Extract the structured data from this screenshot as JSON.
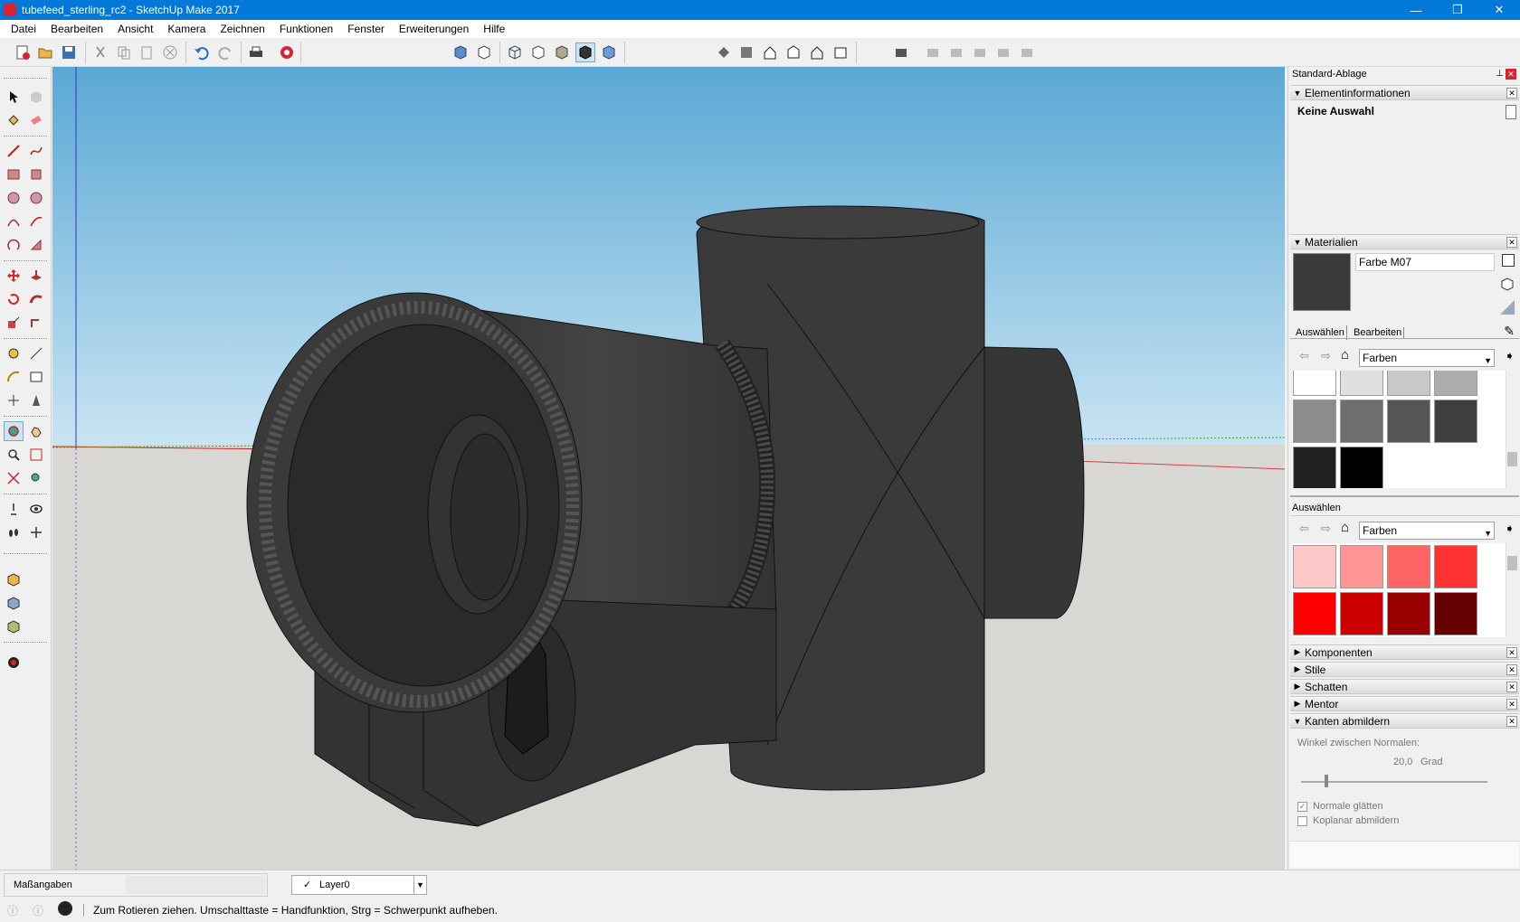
{
  "window": {
    "title": "tubefeed_sterling_rc2 - SketchUp Make 2017",
    "minimize": "—",
    "restore": "❐",
    "close": "✕"
  },
  "menu": [
    "Datei",
    "Bearbeiten",
    "Ansicht",
    "Kamera",
    "Zeichnen",
    "Funktionen",
    "Fenster",
    "Erweiterungen",
    "Hilfe"
  ],
  "panel": {
    "title": "Standard-Ablage",
    "entity_info": {
      "header": "Elementinformationen",
      "selection": "Keine Auswahl"
    },
    "materials": {
      "header": "Materialien",
      "material_name": "Farbe M07",
      "tab_select": "Auswählen",
      "tab_edit": "Bearbeiten",
      "library": "Farben",
      "current_color": "#3a3a3a",
      "gray_swatches": [
        "#ffffff",
        "#e0e0e0",
        "#c8c8c8",
        "#acacac",
        "#8c8c8c",
        "#6e6e6e",
        "#555555",
        "#3e3e3e",
        "#222222",
        "#000000"
      ],
      "secondary_label": "Auswählen",
      "secondary_library": "Farben",
      "red_swatches": [
        "#ffc8c8",
        "#ff9696",
        "#ff6464",
        "#ff3232",
        "#ff0000",
        "#cc0000",
        "#990000",
        "#660000"
      ]
    },
    "collapsed_sections": [
      "Komponenten",
      "Stile",
      "Schatten",
      "Mentor"
    ],
    "soften_edges": {
      "header": "Kanten abmildern",
      "angle_label": "Winkel zwischen Normalen:",
      "angle_value": "20,0",
      "angle_unit": "Grad",
      "smooth_normals": "Normale glätten",
      "soften_coplanar": "Koplanar abmildern"
    }
  },
  "status": {
    "measurements_label": "Maßangaben",
    "layer": "Layer0",
    "message": "Zum Rotieren ziehen. Umschalttaste = Handfunktion, Strg = Schwerpunkt aufheben."
  }
}
